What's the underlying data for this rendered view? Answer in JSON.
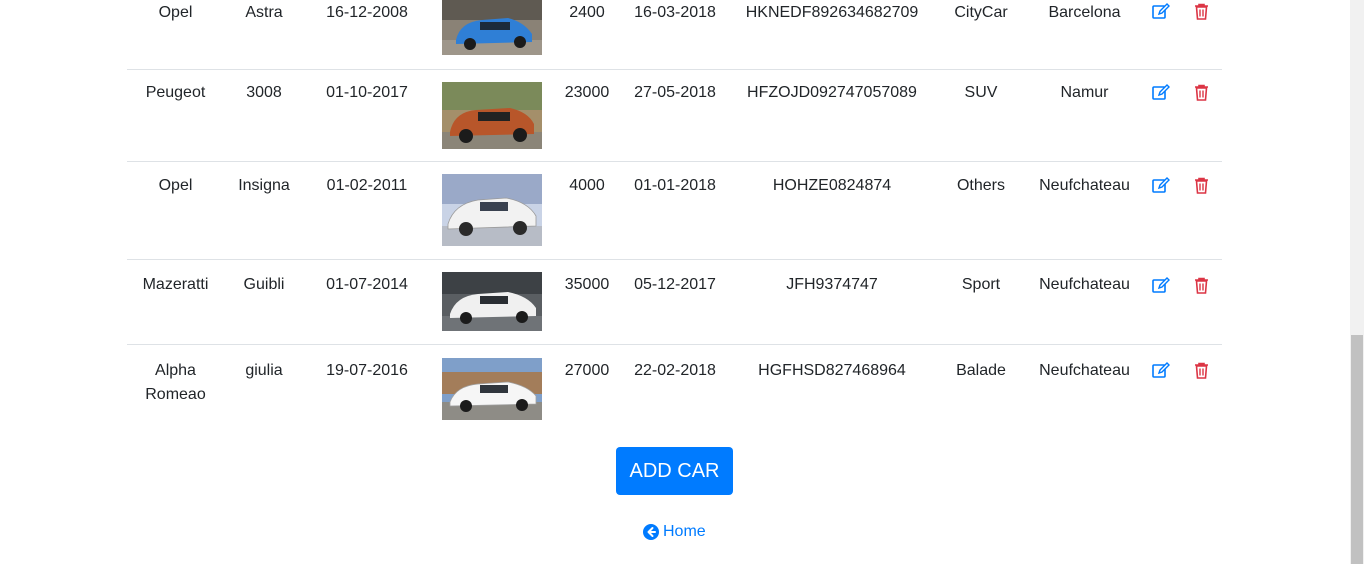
{
  "cars": [
    {
      "brand": "Opel",
      "model": "Astra",
      "first_registration": "16-12-2008",
      "image": "blue-hatchback-photo",
      "km": "2400",
      "purchase_date": "16-03-2018",
      "vin": "HKNEDF892634682709",
      "category": "CityCar",
      "location": "Barcelona"
    },
    {
      "brand": "Peugeot",
      "model": "3008",
      "first_registration": "01-10-2017",
      "image": "orange-suv-photo",
      "km": "23000",
      "purchase_date": "27-05-2018",
      "vin": "HFZOJD092747057089",
      "category": "SUV",
      "location": "Namur"
    },
    {
      "brand": "Opel",
      "model": "Insigna",
      "first_registration": "01-02-2011",
      "image": "white-sedan-photo",
      "km": "4000",
      "purchase_date": "01-01-2018",
      "vin": "HOHZE0824874",
      "category": "Others",
      "location": "Neufchateau"
    },
    {
      "brand": "Mazeratti",
      "model": "Guibli",
      "first_registration": "01-07-2014",
      "image": "white-sport-sedan-photo",
      "km": "35000",
      "purchase_date": "05-12-2017",
      "vin": "JFH9374747",
      "category": "Sport",
      "location": "Neufchateau"
    },
    {
      "brand": "Alpha Romeao",
      "model": "giulia",
      "first_registration": "19-07-2016",
      "image": "white-sedan-driveway-photo",
      "km": "27000",
      "purchase_date": "22-02-2018",
      "vin": "HGFHSD827468964",
      "category": "Balade",
      "location": "Neufchateau"
    }
  ],
  "actions": {
    "edit_icon": "edit-icon",
    "delete_icon": "trash-icon"
  },
  "add_button": {
    "label": "ADD CAR"
  },
  "home_link": {
    "label": "Home",
    "icon": "arrow-circle-left-icon"
  },
  "colors": {
    "primary": "#007bff",
    "danger": "#dc3545",
    "row_border": "#dee2e6",
    "car_blue": "#2f7fd6",
    "car_orange": "#b8562a",
    "car_white": "#f2f2f2"
  }
}
